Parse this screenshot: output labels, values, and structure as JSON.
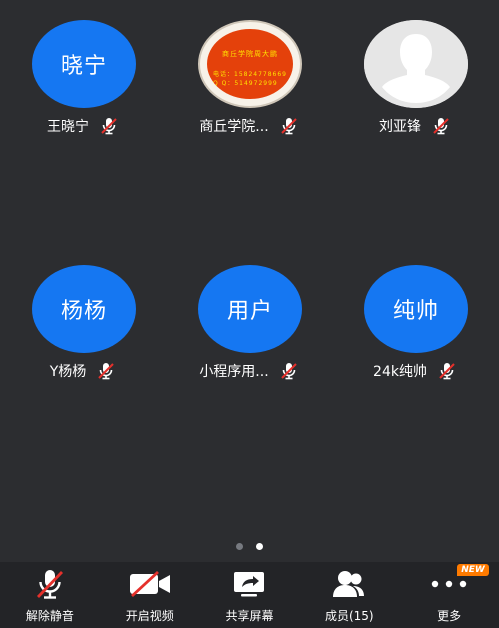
{
  "participants": [
    {
      "avatar_text": "晓宁",
      "name": "王晓宁",
      "avatar_type": "initials"
    },
    {
      "avatar_text": "",
      "name": "商丘学院...",
      "avatar_type": "logo",
      "logo": {
        "title": "商丘学院周大鹏",
        "phone": "电话：15824778669",
        "qq": "Q Q：514972999"
      }
    },
    {
      "avatar_text": "",
      "name": "刘亚锋",
      "avatar_type": "default-person"
    },
    {
      "avatar_text": "杨杨",
      "name": "Y杨杨",
      "avatar_type": "initials"
    },
    {
      "avatar_text": "用户",
      "name": "小程序用...",
      "avatar_type": "initials"
    },
    {
      "avatar_text": "纯帅",
      "name": "24k纯帅",
      "avatar_type": "initials"
    }
  ],
  "pager": {
    "total": 2,
    "current": 2
  },
  "toolbar": {
    "unmute": "解除静音",
    "start_video": "开启视频",
    "share_screen": "共享屏幕",
    "members": "成员(15)",
    "more": "更多",
    "new_badge": "NEW"
  },
  "colors": {
    "avatar_blue": "#1577f2",
    "background": "#2c2d30",
    "toolbar": "#232427",
    "mute_red": "#e5302b",
    "badge": "#ff7b00"
  }
}
